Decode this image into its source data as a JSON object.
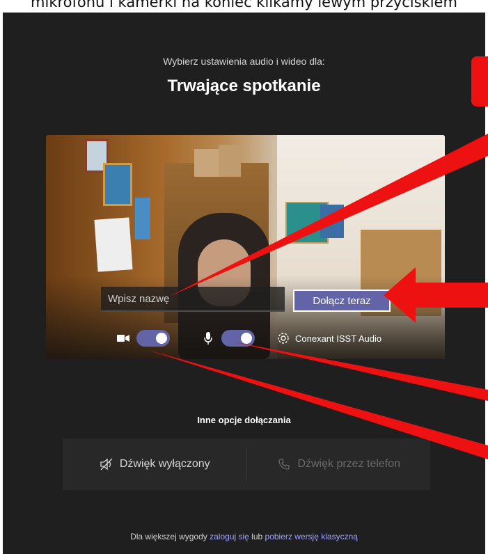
{
  "caption": "mikrofonu i kamerki na koniec klikamy lewym przyciskiem",
  "prompt": "Wybierz ustawienia audio i wideo dla:",
  "meeting_title": "Trwające spotkanie",
  "name_input": {
    "placeholder": "Wpisz nazwę"
  },
  "join_button": "Dołącz teraz",
  "camera_toggle_on": true,
  "mic_toggle_on": true,
  "device_settings_label": "Conexant ISST Audio",
  "other_options": {
    "label": "Inne opcje dołączania",
    "audio_off": "Dźwięk wyłączony",
    "phone_audio": "Dźwięk przez telefon"
  },
  "footer": {
    "prefix": "Dla większej wygody",
    "sign_in": "zaloguj się",
    "middle": "lub",
    "download": "pobierz wersję klasyczną"
  },
  "colors": {
    "background": "#201f1f",
    "accent": "#6264a7",
    "annotation_red": "#ee1111",
    "link": "#9ea2ff"
  }
}
